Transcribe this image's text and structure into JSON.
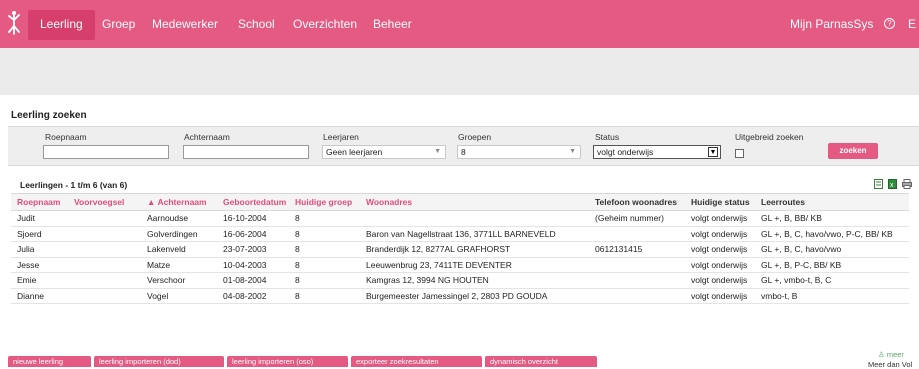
{
  "nav": {
    "items": [
      {
        "label": "Leerling"
      },
      {
        "label": "Groep"
      },
      {
        "label": "Medewerker"
      },
      {
        "label": "School"
      },
      {
        "label": "Overzichten"
      },
      {
        "label": "Beheer"
      }
    ],
    "account_label": "Mijn ParnasSys",
    "help_icon": "?",
    "extra_label": "E"
  },
  "page_title": "Leerling zoeken",
  "search": {
    "roepnaam_label": "Roepnaam",
    "roepnaam_value": "",
    "achternaam_label": "Achternaam",
    "achternaam_value": "",
    "leerjaren_label": "Leerjaren",
    "leerjaren_value": "Geen leerjaren",
    "groepen_label": "Groepen",
    "groepen_value": "8",
    "status_label": "Status",
    "status_value": "volgt onderwijs",
    "uitgebreid_label": "Uitgebreid zoeken",
    "zoeken_button": "zoeken"
  },
  "results": {
    "caption": "Leerlingen - 1 t/m 6 (van 6)",
    "columns": [
      "Roepnaam",
      "Voorvoegsel",
      "▲ Achternaam",
      "Geboortedatum",
      "Huidige groep",
      "Woonadres",
      "Telefoon woonadres",
      "Huidige status",
      "Leerroutes"
    ],
    "rows": [
      [
        "Judit",
        "",
        "Aarnoudse",
        "16-10-2004",
        "8",
        "",
        "(Geheim nummer)",
        "volgt onderwijs",
        "GL +, B, BB/ KB"
      ],
      [
        "Sjoerd",
        "",
        "Golverdingen",
        "16-06-2004",
        "8",
        "Baron van Nagellstraat 136, 3771LL BARNEVELD",
        "",
        "volgt onderwijs",
        "GL +, B, C, havo/vwo, P-C, BB/ KB"
      ],
      [
        "Julia",
        "",
        "Lakenveld",
        "23-07-2003",
        "8",
        "Branderdijk 12, 8277AL GRAFHORST",
        "0612131415",
        "volgt onderwijs",
        "GL +, B, C, havo/vwo"
      ],
      [
        "Jesse",
        "",
        "Matze",
        "10-04-2003",
        "8",
        "Leeuwenbrug 23, 7411TE DEVENTER",
        "",
        "volgt onderwijs",
        "GL +, B, P-C, BB/ KB"
      ],
      [
        "Emie",
        "",
        "Verschoor",
        "01-08-2004",
        "8",
        "Kamgras 12, 3994 NG HOUTEN",
        "",
        "volgt onderwijs",
        "GL +, vmbo-t, B, C"
      ],
      [
        "Dianne",
        "",
        "Vogel",
        "04-08-2002",
        "8",
        "Burgemeester Jamessingel 2, 2803 PD GOUDA",
        "",
        "volgt onderwijs",
        "vmbo-t, B"
      ]
    ]
  },
  "bottom_buttons": [
    {
      "label": "nieuwe leerling"
    },
    {
      "label": "leerling importeren (dod)"
    },
    {
      "label": "leerling importeren (oso)"
    },
    {
      "label": "exporteer zoekresultaten"
    },
    {
      "label": "dynamisch overzicht"
    }
  ],
  "side": {
    "meer_label": "meer",
    "meer_voor_label": "Meer dan Vol"
  },
  "colors": {
    "brand": "#e45a83",
    "brand_dark": "#d63f6c",
    "panel": "#eeeeee"
  },
  "icons": [
    "logo-icon",
    "help-icon",
    "export-icon",
    "excel-icon",
    "print-icon",
    "person-icon"
  ]
}
